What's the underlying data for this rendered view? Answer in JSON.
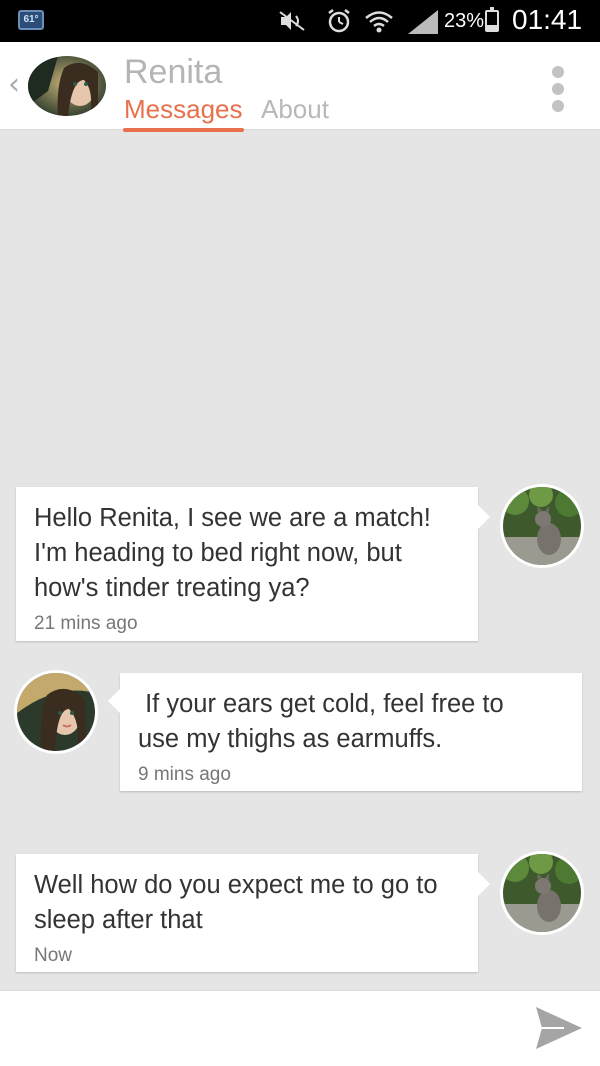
{
  "status_bar": {
    "temperature": "61°",
    "battery_percent": "23%",
    "time": "01:41",
    "icons": [
      "mute-icon",
      "alarm-icon",
      "wifi-icon",
      "signal-icon",
      "battery-charging-icon"
    ]
  },
  "header": {
    "name": "Renita",
    "tabs": [
      {
        "label": "Messages",
        "active": true
      },
      {
        "label": "About",
        "active": false
      }
    ]
  },
  "messages": [
    {
      "direction": "outgoing",
      "text_lines": [
        "Hello Renita, I see we are a match!",
        "I'm heading to bed right now, but",
        "how's tinder treating ya?"
      ],
      "time": "21 mins ago"
    },
    {
      "direction": "incoming",
      "text_lines": [
        " If your ears get cold, feel free to",
        "use my thighs as earmuffs."
      ],
      "time": "9 mins ago"
    },
    {
      "direction": "outgoing",
      "text_lines": [
        "Well how do you expect me to go to",
        "sleep after that"
      ],
      "time": "Now"
    }
  ],
  "colors": {
    "accent": "#e8704c",
    "background": "#e5e5e5",
    "bubble": "#ffffff"
  }
}
